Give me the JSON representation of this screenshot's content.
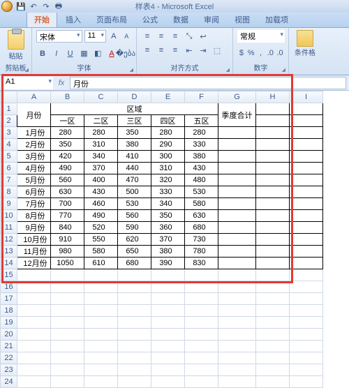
{
  "title": "样表4 - Microsoft Excel",
  "tabs": [
    "开始",
    "插入",
    "页面布局",
    "公式",
    "数据",
    "审阅",
    "视图",
    "加载项"
  ],
  "ribbon": {
    "clipboard": {
      "paste": "粘贴",
      "label": "剪贴板"
    },
    "font": {
      "name": "宋体",
      "size": "11",
      "label": "字体"
    },
    "align": {
      "label": "对齐方式"
    },
    "number": {
      "format": "常规",
      "label": "数字"
    },
    "cond": "条件格"
  },
  "namebox": "A1",
  "formula": "月份",
  "cols": [
    "A",
    "B",
    "C",
    "D",
    "E",
    "F",
    "G",
    "H",
    "I"
  ],
  "table": {
    "h_month": "月份",
    "h_region": "区域",
    "h_total": "季度合计",
    "regions": [
      "一区",
      "二区",
      "三区",
      "四区",
      "五区"
    ]
  },
  "chart_data": {
    "type": "table",
    "title": "月份 × 区域",
    "categories": [
      "1月份",
      "2月份",
      "3月份",
      "4月份",
      "5月份",
      "6月份",
      "7月份",
      "8月份",
      "9月份",
      "10月份",
      "11月份",
      "12月份"
    ],
    "series": [
      {
        "name": "一区",
        "values": [
          280,
          350,
          420,
          490,
          560,
          630,
          700,
          770,
          840,
          910,
          980,
          1050
        ]
      },
      {
        "name": "二区",
        "values": [
          280,
          310,
          340,
          370,
          400,
          430,
          460,
          490,
          520,
          550,
          580,
          610
        ]
      },
      {
        "name": "三区",
        "values": [
          350,
          380,
          410,
          440,
          470,
          500,
          530,
          560,
          590,
          620,
          650,
          680
        ]
      },
      {
        "name": "四区",
        "values": [
          280,
          290,
          300,
          310,
          320,
          330,
          340,
          350,
          360,
          370,
          380,
          390
        ]
      },
      {
        "name": "五区",
        "values": [
          280,
          330,
          380,
          430,
          480,
          530,
          580,
          630,
          680,
          730,
          780,
          830
        ]
      }
    ]
  }
}
